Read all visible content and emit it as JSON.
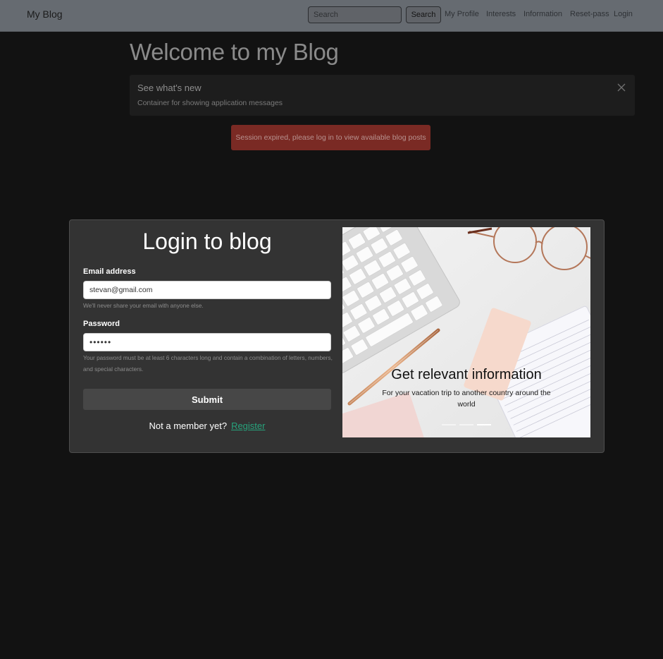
{
  "navbar": {
    "brand": "My Blog",
    "search_placeholder": "Search",
    "search_button": "Search",
    "links": {
      "my_profile": "My Profile",
      "interests": "Interests",
      "information": "Information",
      "reset_pass": "Reset-pass",
      "login": "Login"
    }
  },
  "main": {
    "title": "Welcome to my Blog",
    "messages_panel": {
      "title": "See what's new",
      "body": "Container for showing application messages"
    },
    "alert": "Session expired, please log in to view available blog posts"
  },
  "login": {
    "title": "Login to blog",
    "email_label": "Email address",
    "email_value": "stevan@gmail.com",
    "email_help": "We'll never share your email with anyone else.",
    "password_label": "Password",
    "password_value": "••••••",
    "password_help": "Your password must be at least 6 characters long and contain a combination of letters, numbers, and special characters.",
    "submit_label": "Submit",
    "member_text": "Not a member yet?",
    "register_link": "Register"
  },
  "carousel": {
    "caption_title": "Get relevant information",
    "caption_text": "For your vacation trip to another country around the world",
    "slide_count": 3,
    "active_slide": 3
  },
  "colors": {
    "navbar_bg": "#666b71",
    "page_bg": "#121212",
    "alert_bg": "#7a2a24",
    "card_bg": "#333333",
    "link_accent": "#27a37c"
  }
}
